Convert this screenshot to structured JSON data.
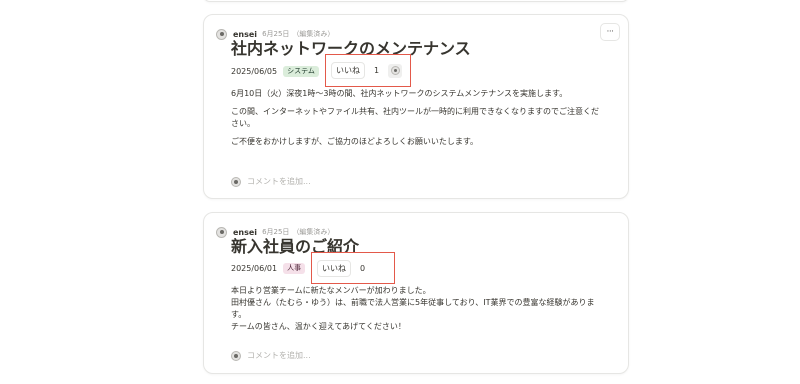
{
  "posts": [
    {
      "author": "ensei",
      "meta_date": "6月25日",
      "edited": "（編集済み）",
      "more": "···",
      "title": "社内ネットワークのメンテナンス",
      "date": "2025/06/05",
      "tag": "システム",
      "like_label": "いいね",
      "like_count": "1",
      "body": [
        "6月10日（火）深夜1時〜3時の間、社内ネットワークのシステムメンテナンスを実施します。",
        "この間、インターネットやファイル共有、社内ツールが一時的に利用できなくなりますのでご注意ください。",
        "ご不便をおかけしますが、ご協力のほどよろしくお願いいたします。"
      ],
      "comment_placeholder": "コメントを追加..."
    },
    {
      "author": "ensei",
      "meta_date": "6月25日",
      "edited": "（編集済み）",
      "title": "新入社員のご紹介",
      "date": "2025/06/01",
      "tag": "人事",
      "like_label": "いいね",
      "like_count": "0",
      "body": [
        "本日より営業チームに新たなメンバーが加わりました。",
        "田村優さん（たむら・ゆう）は、前職で法人営業に5年従事しており、IT業界での豊富な経験があります。",
        "チームの皆さん、温かく迎えてあげてください！"
      ],
      "comment_placeholder": "コメントを追加..."
    }
  ]
}
